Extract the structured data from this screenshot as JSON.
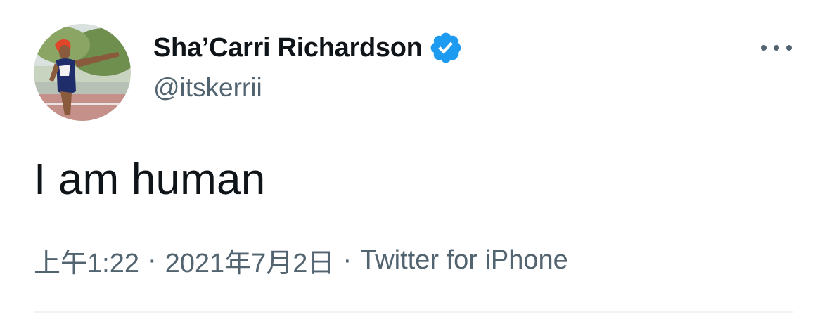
{
  "author": {
    "display_name": "Sha’Carri Richardson",
    "handle": "@itskerrii",
    "verified": true,
    "verified_icon": "verified-badge-icon",
    "avatar_icon": "profile-photo-avatar"
  },
  "tweet": {
    "text": "I am human",
    "time": "上午1:22",
    "date": "2021年7月2日",
    "source": "Twitter for iPhone",
    "separator": "·"
  },
  "menu": {
    "icon": "more-options-icon"
  },
  "colors": {
    "text_primary": "#0f1419",
    "text_secondary": "#536471",
    "verified_blue": "#1d9bf0",
    "divider": "#eff3f4"
  }
}
